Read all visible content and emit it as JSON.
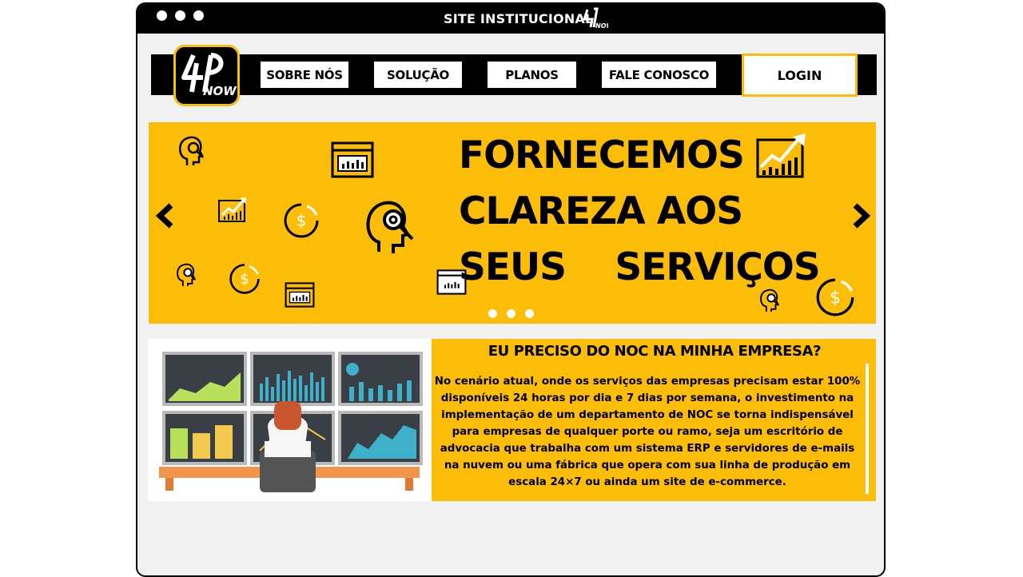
{
  "window": {
    "title": "SITE INSTITUCIONAL",
    "controls": [
      "dot-1",
      "dot-2",
      "dot-3"
    ]
  },
  "logo": {
    "text": "4P",
    "subtext": "NOW"
  },
  "nav": {
    "items": [
      {
        "label": "SOBRE NÓS"
      },
      {
        "label": "SOLUÇÃO"
      },
      {
        "label": "PLANOS"
      },
      {
        "label": "FALE CONOSCO"
      }
    ],
    "login_label": "LOGIN"
  },
  "banner": {
    "lines": [
      "FORNECEMOS",
      "CLAREZA AOS",
      "SEUS    SERVIÇOS"
    ],
    "prev_icon": "chevron-left-icon",
    "next_icon": "chevron-right-icon",
    "slide_count": 3
  },
  "info": {
    "title": "EU PRECISO DO NOC NA MINHA EMPRESA?",
    "text": "No cenário atual, onde os serviços das empresas precisam estar 100% disponíveis 24 horas por dia e 7 dias por semana, o investimento na implementação de um departamento de NOC se torna indispensável para empresas de qualquer porte ou ramo, seja um escritório de advocacia que trabalha com um sistema ERP e servidores de e-mails na nuvem ou uma fábrica que opera com sua linha de produção em escala 24×7 ou ainda um site de e-commerce."
  },
  "colors": {
    "accent": "#fbbd07",
    "dark": "#000000",
    "background": "#f1f1f1"
  }
}
